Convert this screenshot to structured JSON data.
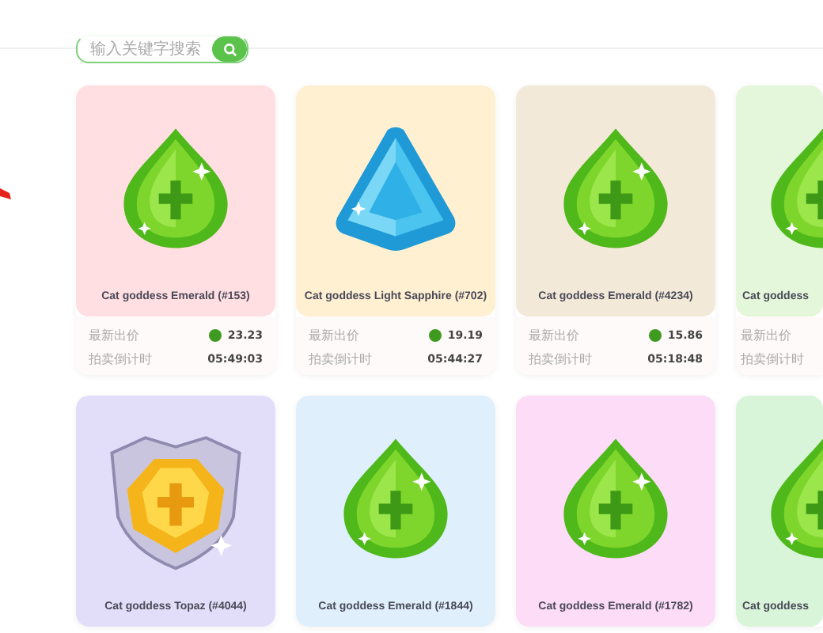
{
  "search": {
    "placeholder": "输入关键字搜索"
  },
  "cards": [
    {
      "title": "Cat goddess Emerald (#153)",
      "kind": "emerald",
      "color": "#ffdfe2",
      "bid_label": "最新出价",
      "bid": "23.23",
      "countdown_label": "拍卖倒计时",
      "countdown": "05:49:03"
    },
    {
      "title": "Cat goddess Light Sapphire (#702)",
      "kind": "sapphire",
      "color": "#fff0d2",
      "bid_label": "最新出价",
      "bid": "19.19",
      "countdown_label": "拍卖倒计时",
      "countdown": "05:44:27"
    },
    {
      "title": "Cat goddess Emerald (#4234)",
      "kind": "emerald",
      "color": "#f3e9d9",
      "bid_label": "最新出价",
      "bid": "15.86",
      "countdown_label": "拍卖倒计时",
      "countdown": "05:18:48"
    },
    {
      "title": "Cat goddess",
      "kind": "emerald",
      "color": "#e4f7da",
      "bid_label": "最新出价",
      "countdown_label": "拍卖倒计时"
    },
    {
      "title": "Cat goddess Topaz (#4044)",
      "kind": "topaz",
      "color": "#e2def9"
    },
    {
      "title": "Cat goddess Emerald (#1844)",
      "kind": "emerald",
      "color": "#dff0fc"
    },
    {
      "title": "Cat goddess Emerald (#1782)",
      "kind": "emerald",
      "color": "#fcdcf6"
    },
    {
      "title": "Cat goddess",
      "kind": "emerald",
      "color": "#d9f5d9"
    }
  ]
}
